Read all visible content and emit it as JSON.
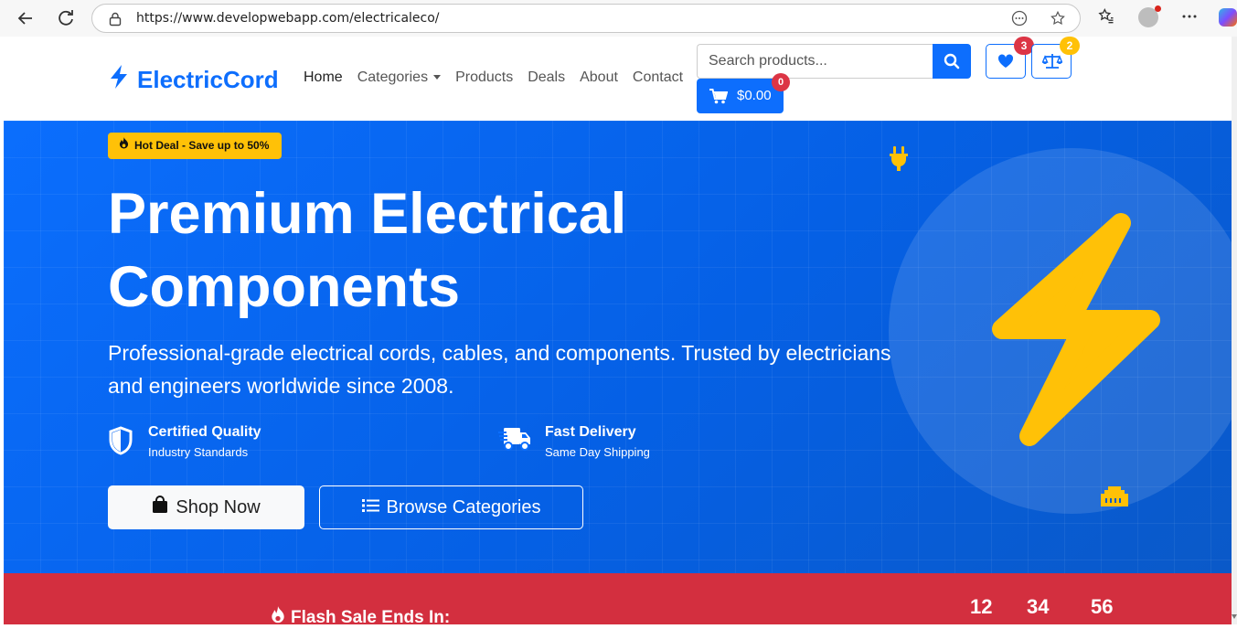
{
  "browser": {
    "url": "https://www.developwebapp.com/electricaleco/"
  },
  "header": {
    "brand": "ElectricCord",
    "nav": [
      "Home",
      "Categories",
      "Products",
      "Deals",
      "About",
      "Contact"
    ],
    "search_placeholder": "Search products...",
    "wishlist_count": "3",
    "compare_count": "2",
    "cart_total": "$0.00",
    "cart_count": "0"
  },
  "hero": {
    "badge": "Hot Deal - Save up to 50%",
    "title_line1": "Premium Electrical",
    "title_line2": "Components",
    "description": "Professional-grade electrical cords, cables, and components. Trusted by electricians and engineers worldwide since 2008.",
    "features": [
      {
        "title": "Certified Quality",
        "subtitle": "Industry Standards"
      },
      {
        "title": "Fast Delivery",
        "subtitle": "Same Day Shipping"
      }
    ],
    "shop_label": "Shop Now",
    "browse_label": "Browse Categories"
  },
  "flash_sale": {
    "label": "Flash Sale Ends In:",
    "hours": "12",
    "minutes": "34",
    "seconds": "56"
  },
  "colors": {
    "primary": "#0d6efd",
    "warning": "#ffc107",
    "danger": "#dc3545",
    "flash_bg": "#d32f3f"
  },
  "icons": {
    "back": "arrow-left-icon",
    "refresh": "refresh-icon",
    "lock": "lock-icon",
    "brand": "lightning-bolt-icon",
    "search": "search-icon",
    "wishlist": "heart-icon",
    "compare": "balance-scale-icon",
    "cart": "shopping-cart-icon",
    "hot": "fire-icon",
    "quality": "shield-icon",
    "delivery": "truck-icon",
    "shop": "shopping-bag-icon",
    "browse": "list-icon"
  }
}
